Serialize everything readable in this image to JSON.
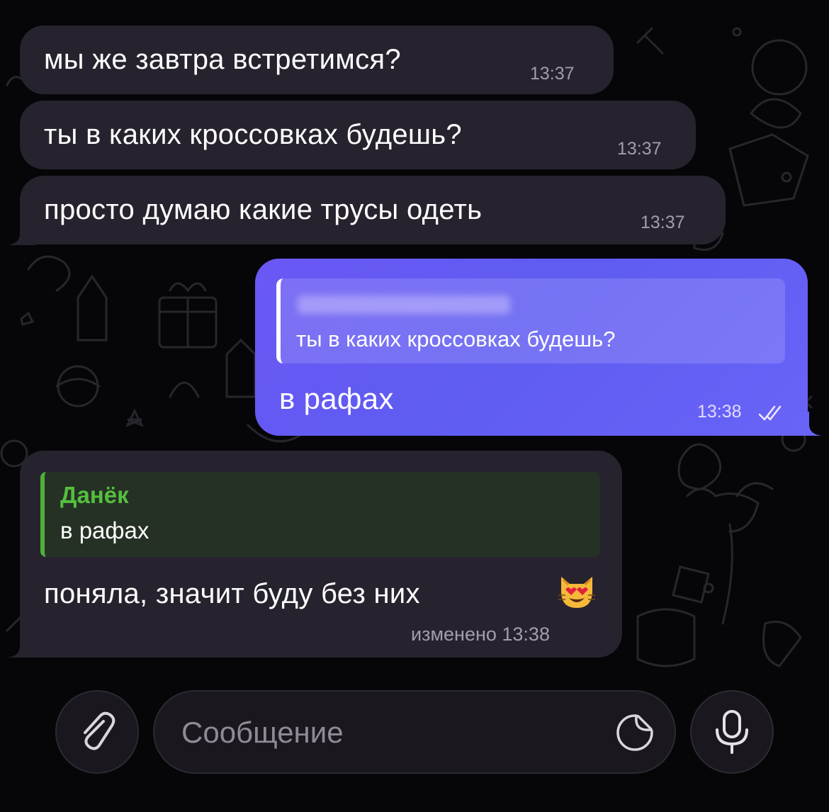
{
  "messages": {
    "incoming_1": {
      "text": "мы же завтра встретимся?",
      "time": "13:37"
    },
    "incoming_2": {
      "text": "ты в каких кроссовках будешь?",
      "time": "13:37"
    },
    "incoming_3": {
      "text": "просто думаю какие трусы одеть",
      "time": "13:37"
    },
    "outgoing_reply": {
      "quote_text": "ты в каких кроссовках будешь?",
      "text": "в рафах",
      "time": "13:38",
      "status_icon": "double-check-icon"
    },
    "incoming_reply": {
      "quote_author": "Данёк",
      "quote_text": "в рафах",
      "text": "поняла, значит буду без них",
      "emoji": "heart-eyes-cat-emoji",
      "time": "изменено 13:38"
    }
  },
  "composer": {
    "placeholder": "Сообщение",
    "attach_icon": "paperclip-icon",
    "sticker_icon": "sticker-icon",
    "mic_icon": "microphone-icon"
  },
  "colors": {
    "background": "#060609",
    "incoming_bubble": "#27232e",
    "outgoing_bubble": "#6a5cf5",
    "quote_accent_green": "#4db13a",
    "timestamp": "#a29dab"
  }
}
